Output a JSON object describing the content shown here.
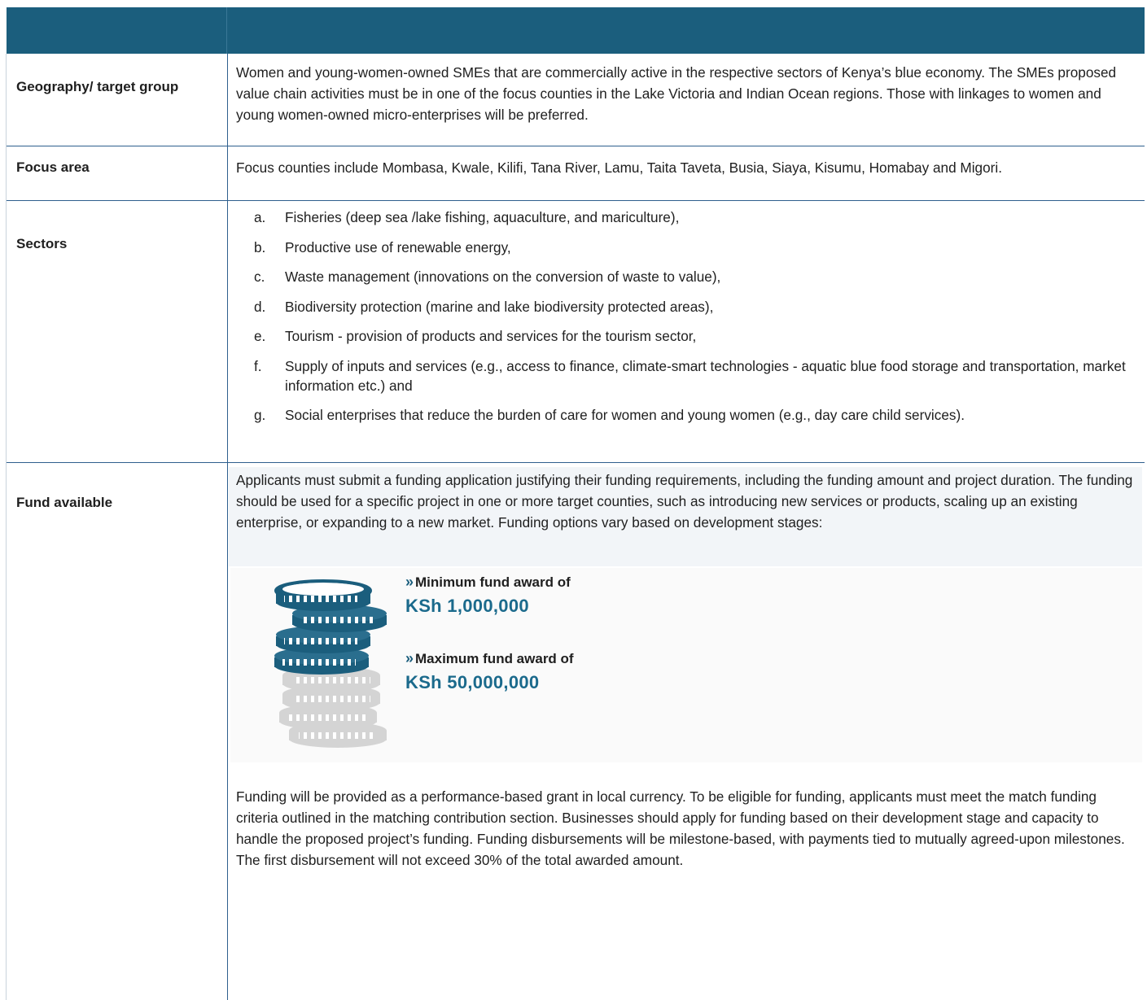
{
  "rows": {
    "geography": {
      "label": "Geography/ target group",
      "text": "Women and young-women-owned SMEs that are commercially active in the respective sectors of Kenya’s blue economy. The SMEs proposed value chain activities must be in one of the focus counties in the Lake Victoria and Indian Ocean regions. Those with linkages to women and young women-owned micro-enterprises will be preferred."
    },
    "focus": {
      "label": "Focus area",
      "text": "Focus counties include Mombasa, Kwale, Kilifi, Tana River, Lamu, Taita Taveta, Busia, Siaya, Kisumu, Homabay and Migori."
    },
    "sectors": {
      "label": "Sectors",
      "items": [
        {
          "letter": "a.",
          "text": "Fisheries (deep sea /lake fishing, aquaculture, and mariculture),"
        },
        {
          "letter": "b.",
          "text": "Productive use of renewable energy,"
        },
        {
          "letter": "c.",
          "text": "Waste management (innovations on the conversion of waste to value),"
        },
        {
          "letter": "d.",
          "text": " Biodiversity protection (marine and lake biodiversity protected areas),"
        },
        {
          "letter": "e.",
          "text": "Tourism - provision of products and services for the tourism sector,"
        },
        {
          "letter": "f.",
          "text": "Supply of inputs and services (e.g., access to finance, climate-smart technologies - aquatic blue food storage and transportation, market information etc.) and"
        },
        {
          "letter": "g.",
          "text": "Social enterprises that reduce the burden of care for women and young women (e.g., day care child services)."
        }
      ]
    },
    "fund": {
      "label": "Fund available",
      "intro": "Applicants must submit a funding application justifying their funding requirements, including the funding amount and project duration. The funding should be used for a specific project in one or more target counties, such as introducing new services or products, scaling up an existing enterprise, or expanding to a new market. Funding options vary based on development stages:",
      "min_caption": "Minimum fund award of",
      "min_amount": "KSh 1,000,000",
      "max_caption": "Maximum fund award of",
      "max_amount": "KSh 50,000,000",
      "details": "Funding will be provided as a performance-based grant in local currency. To be eligible for funding, applicants must meet the match funding criteria outlined in the matching contribution section. Businesses should apply for funding based on their development stage and capacity to handle the proposed project’s funding. Funding disbursements will be milestone-based, with payments tied to mutually agreed-upon milestones. The first disbursement will not exceed 30% of the total awarded amount."
    }
  },
  "colors": {
    "header": "#1b5e7d",
    "accent": "#1b6a8c",
    "coin_gray": "#d4d4d4"
  }
}
